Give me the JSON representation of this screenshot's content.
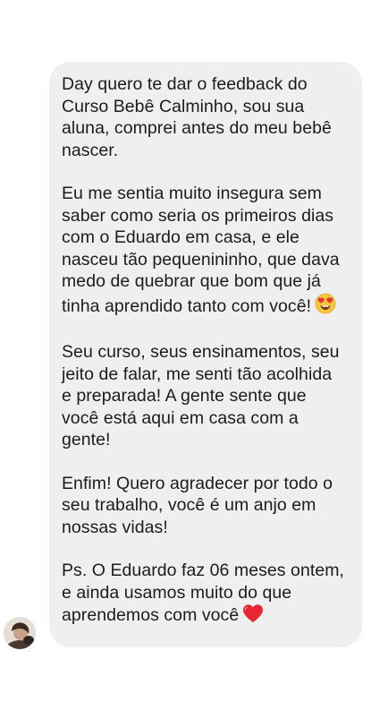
{
  "message": {
    "paragraphs": [
      {
        "text": "Day quero te dar o feedback do\nCurso Bebê Calminho, sou sua\naluna, comprei antes do meu bebê\nnascer."
      },
      {
        "text": "Eu me sentia muito insegura sem\nsaber como seria os primeiros dias\ncom o Eduardo em casa, e ele\nnasceu tão pequenininho, que dava\nmedo de quebrar que bom que já\ntinha aprendido tanto com você!",
        "emoji": "heart-eyes-emoji"
      },
      {
        "text": "Seu curso, seus ensinamentos, seu\njeito de falar, me senti tão acolhida\ne preparada! A gente sente que\nvocê está aqui em casa com a\ngente!"
      },
      {
        "text": "Enfim! Quero agradecer por todo o\nseu trabalho, você é um anjo em\nnossas vidas!"
      },
      {
        "text": "Ps. O Eduardo faz 06 meses ontem,\ne ainda usamos muito do que\naprendemos com você",
        "emoji": "red-heart-emoji"
      }
    ]
  },
  "colors": {
    "bubble": "#efefef",
    "text": "#1c1c1c",
    "background": "#ffffff"
  }
}
